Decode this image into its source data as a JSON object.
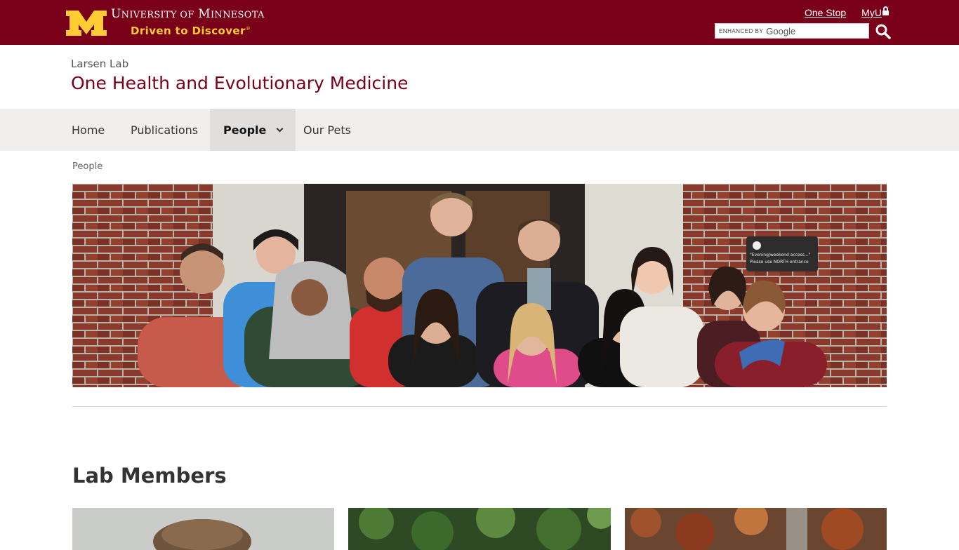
{
  "header": {
    "wordmark": {
      "first_initial": "U",
      "first_rest": "NIVERSITY OF",
      "second_initial": "M",
      "second_rest": "INNESOTA"
    },
    "tagline": "Driven to Discover",
    "tagline_mark": "®",
    "links": [
      {
        "label": "One Stop"
      },
      {
        "label": "MyU"
      }
    ],
    "search": {
      "enhanced_by": "ENHANCED BY",
      "provider": "Google"
    },
    "colors": {
      "maroon": "#7a0019",
      "gold": "#ffcc33"
    }
  },
  "site": {
    "parent": "Larsen Lab",
    "title": "One Health and Evolutionary Medicine"
  },
  "nav": {
    "items": [
      {
        "label": "Home"
      },
      {
        "label": "Publications"
      },
      {
        "label": "People",
        "active": true
      },
      {
        "label": "Our Pets"
      }
    ]
  },
  "breadcrumb": "People",
  "hero": {
    "sign_line1": "\"Evening/weekend access...\"",
    "sign_line2": "Please use NORTH entrance"
  },
  "main": {
    "section_title": "Lab Members"
  }
}
